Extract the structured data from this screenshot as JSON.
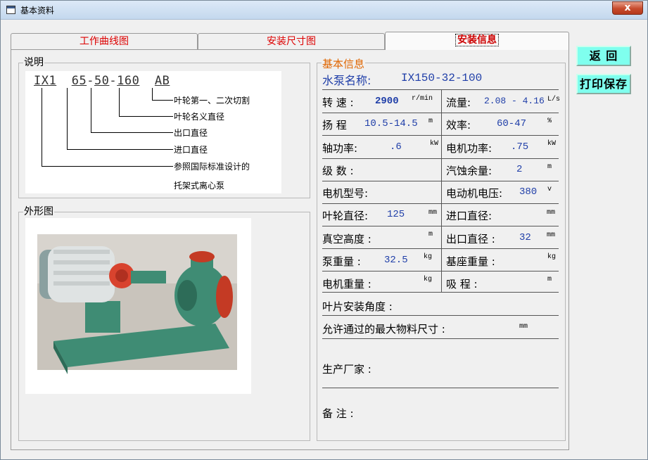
{
  "window": {
    "title": "基本资料",
    "close_symbol": "x"
  },
  "tabs": [
    {
      "label": "工作曲线图"
    },
    {
      "label": "安装尺寸图"
    },
    {
      "label": "安装信息"
    }
  ],
  "description": {
    "group_label": "说明",
    "code": [
      "IX1",
      "65",
      "-",
      "50",
      "-",
      "160",
      "AB"
    ],
    "notes": [
      "叶轮第一、二次切割",
      "叶轮名义直径",
      "出口直径",
      "进口直径",
      "参照国际标准设计的",
      "托架式离心泵"
    ]
  },
  "outline": {
    "group_label": "外形图"
  },
  "info": {
    "group_label": "基本信息",
    "pump_name_label": "水泵名称:",
    "pump_name_value": "IX150-32-100",
    "speed_label": "转 速 :",
    "speed_value": "2900",
    "speed_unit": "r/min",
    "flow_label": "流量:",
    "flow_value": "2.08 - 4.16",
    "flow_unit": "L/s",
    "head_label": "扬 程",
    "head_value": "10.5-14.5",
    "head_unit": "m",
    "eff_label": "效率:",
    "eff_value": "60-47",
    "eff_unit": "%",
    "shaft_label": "轴功率:",
    "shaft_value": ".6",
    "shaft_unit": "kW",
    "motor_power_label": "电机功率:",
    "motor_power_value": ".75",
    "motor_power_unit": "kW",
    "stage_label": "级 数 :",
    "npsh_label": "汽蚀余量:",
    "npsh_value": "2",
    "npsh_unit": "m",
    "motor_model_label": "电机型号:",
    "voltage_label": "电动机电压:",
    "voltage_value": "380",
    "voltage_unit": "v",
    "impeller_label": "叶轮直径:",
    "impeller_value": "125",
    "impeller_unit": "mm",
    "inlet_label": "进口直径:",
    "inlet_unit": "mm",
    "vacuum_label": "真空高度 :",
    "vacuum_unit": "m",
    "outlet_label": "出口直径 :",
    "outlet_value": "32",
    "outlet_unit": "mm",
    "pump_weight_label": "泵重量 :",
    "pump_weight_value": "32.5",
    "pump_weight_unit": "kg",
    "base_weight_label": "基座重量 :",
    "base_weight_unit": "kg",
    "motor_weight_label": "电机重量 :",
    "motor_weight_unit": "kg",
    "suction_label": "吸 程 :",
    "suction_unit": "m",
    "blade_angle_label": "叶片安装角度 :",
    "max_particle_label": "允许通过的最大物料尺寸 :",
    "max_particle_unit": "mm",
    "manufacturer_label": "生产厂家 :",
    "remarks_label": "备 注 :"
  },
  "buttons": {
    "back": "返 回",
    "print_save": "打印保存"
  }
}
